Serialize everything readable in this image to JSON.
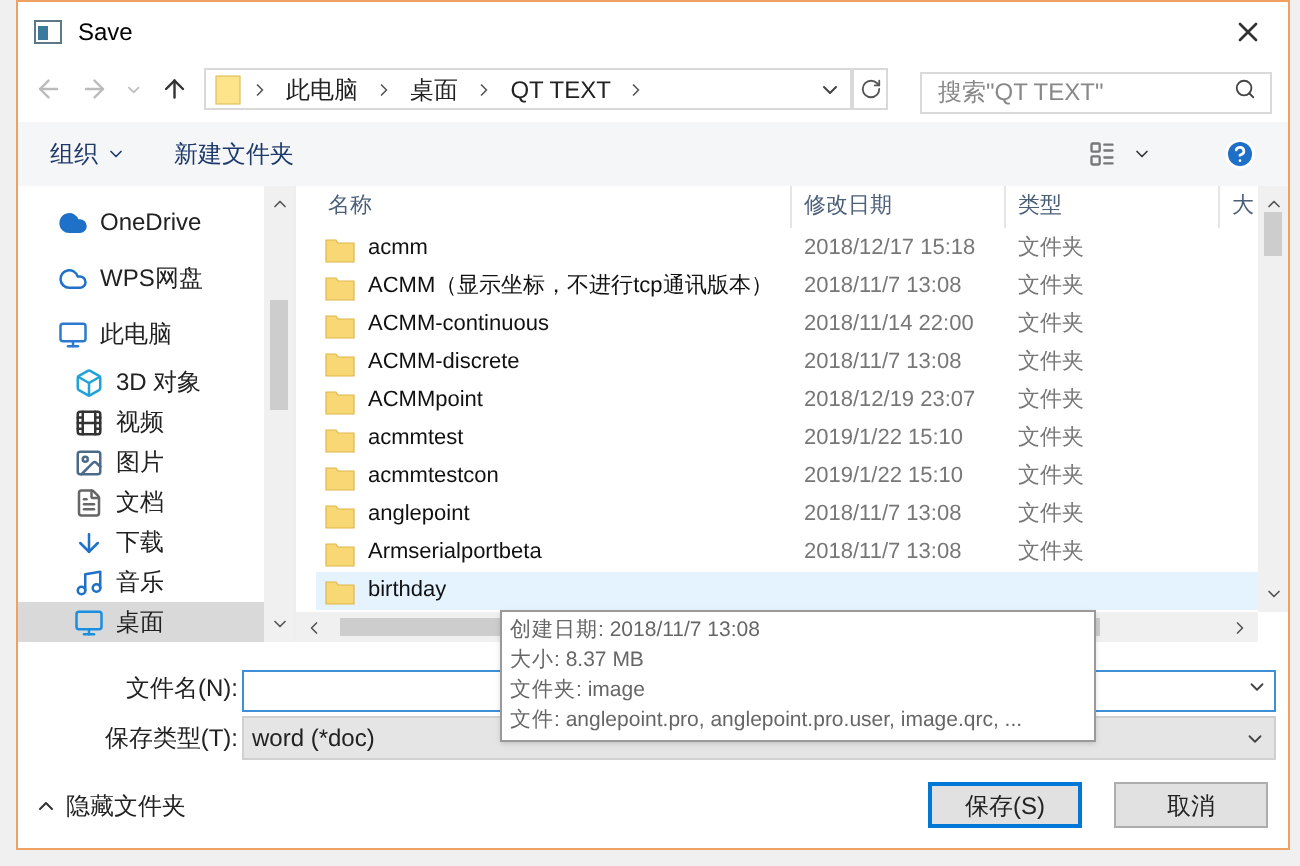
{
  "window": {
    "title": "Save"
  },
  "breadcrumb": [
    "此电脑",
    "桌面",
    "QT TEXT"
  ],
  "search": {
    "placeholder": "搜索\"QT TEXT\""
  },
  "toolbar": {
    "organize": "组织",
    "new_folder": "新建文件夹"
  },
  "sidebar": {
    "items": [
      {
        "label": "OneDrive",
        "kind": "cloud",
        "selected": false
      },
      {
        "label": "WPS网盘",
        "kind": "cloud-outline",
        "selected": false
      },
      {
        "label": "此电脑",
        "kind": "computer",
        "selected": false,
        "children": [
          {
            "label": "3D 对象",
            "kind": "cube",
            "selected": false
          },
          {
            "label": "视频",
            "kind": "film",
            "selected": false
          },
          {
            "label": "图片",
            "kind": "image",
            "selected": false
          },
          {
            "label": "文档",
            "kind": "document",
            "selected": false
          },
          {
            "label": "下载",
            "kind": "download",
            "selected": false
          },
          {
            "label": "音乐",
            "kind": "music",
            "selected": false
          },
          {
            "label": "桌面",
            "kind": "desktop",
            "selected": true
          }
        ]
      }
    ]
  },
  "table": {
    "columns": [
      "名称",
      "修改日期",
      "类型",
      "大"
    ],
    "rows": [
      {
        "name": "acmm",
        "date": "2018/12/17 15:18",
        "type": "文件夹",
        "selected": false
      },
      {
        "name": "ACMM（显示坐标，不进行tcp通讯版本）",
        "date": "2018/11/7 13:08",
        "type": "文件夹",
        "selected": false
      },
      {
        "name": "ACMM-continuous",
        "date": "2018/11/14 22:00",
        "type": "文件夹",
        "selected": false
      },
      {
        "name": "ACMM-discrete",
        "date": "2018/11/7 13:08",
        "type": "文件夹",
        "selected": false
      },
      {
        "name": "ACMMpoint",
        "date": "2018/12/19 23:07",
        "type": "文件夹",
        "selected": false
      },
      {
        "name": "acmmtest",
        "date": "2019/1/22 15:10",
        "type": "文件夹",
        "selected": false
      },
      {
        "name": "acmmtestcon",
        "date": "2019/1/22 15:10",
        "type": "文件夹",
        "selected": false
      },
      {
        "name": "anglepoint",
        "date": "2018/11/7 13:08",
        "type": "文件夹",
        "selected": false
      },
      {
        "name": "Armserialportbeta",
        "date": "2018/11/7 13:08",
        "type": "文件夹",
        "selected": false
      },
      {
        "name": "birthday",
        "selected": true
      }
    ]
  },
  "tooltip": [
    "创建日期: 2018/11/7 13:08",
    "大小: 8.37 MB",
    "文件夹: image",
    "文件: anglepoint.pro, anglepoint.pro.user, image.qrc, ..."
  ],
  "file_name": {
    "label": "文件名(N):"
  },
  "file_type": {
    "label": "保存类型(T):",
    "value": "word (*doc)"
  },
  "hide_folders": "隐藏文件夹",
  "buttons": [
    {
      "label": "保存(S)",
      "default": true
    },
    {
      "label": "取消",
      "default": false
    }
  ]
}
